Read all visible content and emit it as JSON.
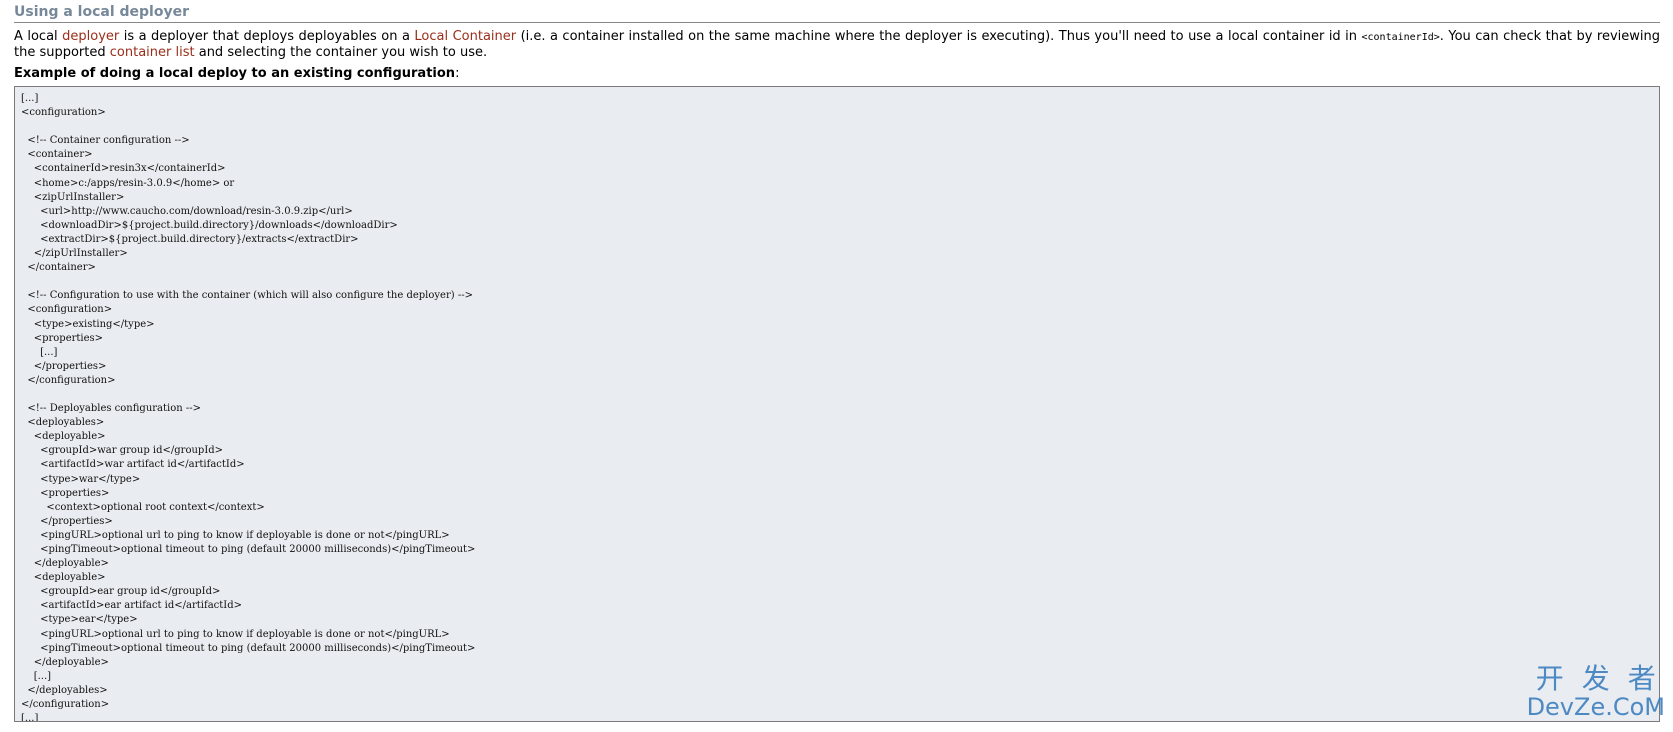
{
  "section": {
    "title": "Using a local deployer"
  },
  "intro": {
    "t1": "A local ",
    "link_deployer": "deployer",
    "t2": " is a deployer that deploys deployables on a ",
    "link_local_container": "Local Container",
    "t3": " (i.e. a container installed on the same machine where the deployer is executing). Thus you'll need to use a local container id in ",
    "code_container_id": "<containerId>",
    "t4": ". You can check that by reviewing the supported ",
    "link_container_list": "container list",
    "t5": " and selecting the container you wish to use."
  },
  "example": {
    "heading": "Example of doing a local deploy to an existing configuration",
    "heading_suffix": ":",
    "code": "[...]\n<configuration>\n\n  <!-- Container configuration -->\n  <container>\n    <containerId>resin3x</containerId>\n    <home>c:/apps/resin-3.0.9</home> or\n    <zipUrlInstaller>\n      <url>http://www.caucho.com/download/resin-3.0.9.zip</url>\n      <downloadDir>${project.build.directory}/downloads</downloadDir>\n      <extractDir>${project.build.directory}/extracts</extractDir>\n    </zipUrlInstaller>\n  </container>\n\n  <!-- Configuration to use with the container (which will also configure the deployer) -->\n  <configuration>\n    <type>existing</type>\n    <properties>\n      [...]\n    </properties>\n  </configuration>\n\n  <!-- Deployables configuration -->\n  <deployables>\n    <deployable>\n      <groupId>war group id</groupId>\n      <artifactId>war artifact id</artifactId>\n      <type>war</type>\n      <properties>\n        <context>optional root context</context>\n      </properties>\n      <pingURL>optional url to ping to know if deployable is done or not</pingURL>\n      <pingTimeout>optional timeout to ping (default 20000 milliseconds)</pingTimeout>\n    </deployable>\n    <deployable>\n      <groupId>ear group id</groupId>\n      <artifactId>ear artifact id</artifactId>\n      <type>ear</type>\n      <pingURL>optional url to ping to know if deployable is done or not</pingURL>\n      <pingTimeout>optional timeout to ping (default 20000 milliseconds)</pingTimeout>\n    </deployable>\n    [...]\n  </deployables>\n</configuration>\n[...]"
  },
  "watermark": {
    "line1": "开发者",
    "line2": "DevZe.CoM"
  },
  "colors": {
    "link": "#9a2e1a",
    "title": "#778899",
    "code_background": "#e9ecf0",
    "watermark": "#3d7fbf"
  }
}
